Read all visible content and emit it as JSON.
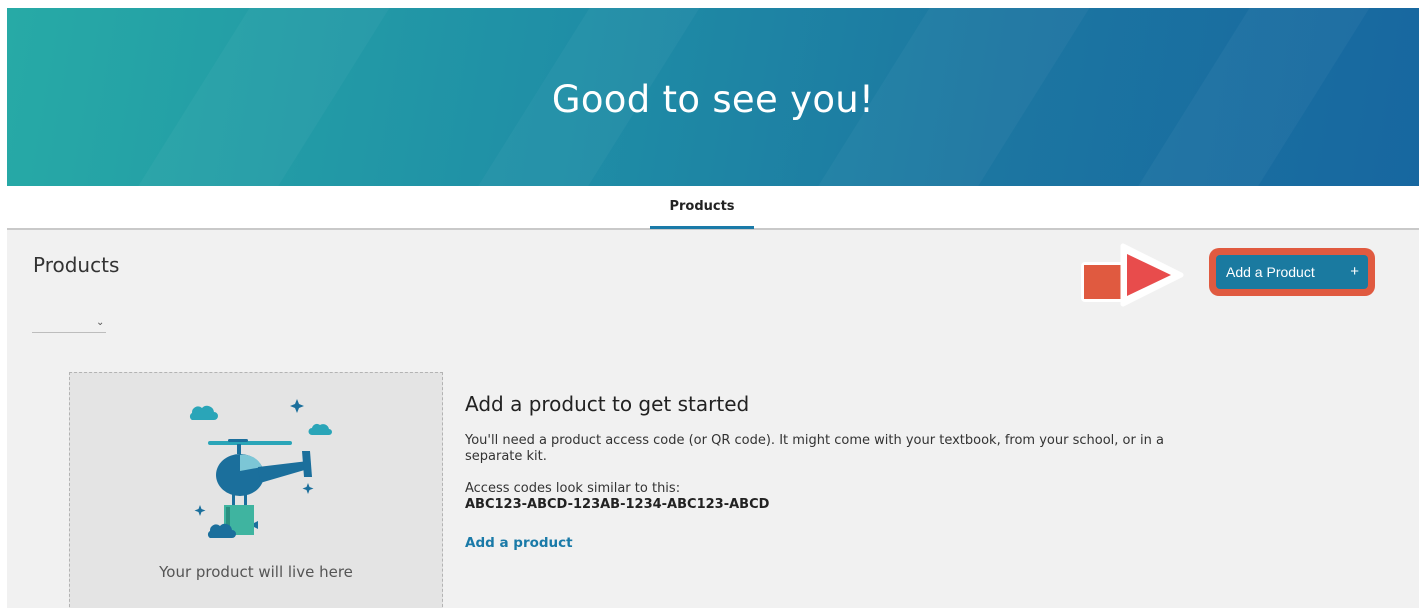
{
  "hero": {
    "title": "Good to see you!"
  },
  "tabs": [
    {
      "label": "Products",
      "active": true
    }
  ],
  "products": {
    "heading": "Products",
    "filter_value": "",
    "add_button": {
      "label": "Add a Product",
      "icon": "plus-icon",
      "symbol": "+"
    }
  },
  "empty_state": {
    "placeholder_caption": "Your product will live here",
    "title": "Add a product to get started",
    "description": "You'll need a product access code (or QR code). It might come with your textbook, from your school, or in a separate kit.",
    "code_hint": "Access codes look similar to this:",
    "code_example": "ABC123-ABCD-123AB-1234-ABC123-ABCD",
    "link_label": "Add a product"
  },
  "colors": {
    "hero_start": "#27aaa6",
    "hero_end": "#1767a0",
    "accent": "#1a7aa8",
    "callout": "#e05a40"
  }
}
